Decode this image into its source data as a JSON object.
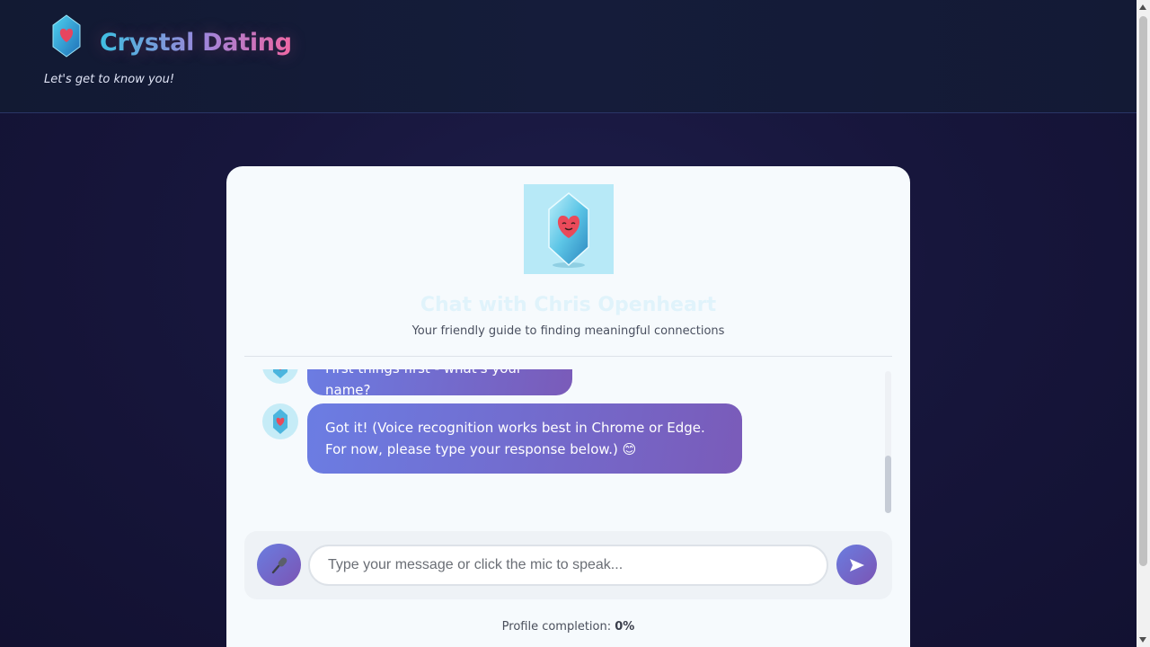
{
  "app": {
    "brand": "Crystal Dating",
    "tagline": "Let's get to know you!"
  },
  "chat": {
    "title": "Chat with Chris Openheart",
    "subtitle": "Your friendly guide to finding meaningful connections",
    "messages": [
      {
        "sender": "bot",
        "text": "First things first - what's your name?"
      },
      {
        "sender": "bot",
        "text": "Got it! (Voice recognition works best in Chrome or Edge. For now, please type your response below.) 😊"
      }
    ]
  },
  "input": {
    "placeholder": "Type your message or click the mic to speak...",
    "value": "",
    "mic_icon": "microphone-icon",
    "send_icon": "send-arrow-icon"
  },
  "progress": {
    "label": "Profile completion:",
    "value": "0%"
  },
  "colors": {
    "accent_start": "#6b7de3",
    "accent_end": "#7a5bb9",
    "brand_cyan": "#36c6e6",
    "brand_pink": "#f06aa6"
  }
}
